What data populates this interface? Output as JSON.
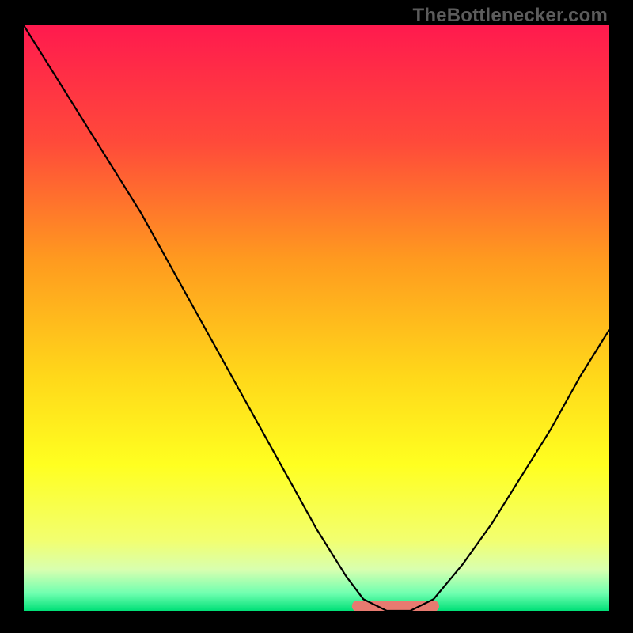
{
  "watermark": {
    "text": "TheBottlenecker.com"
  },
  "gradient": {
    "stops": [
      {
        "offset": 0.0,
        "color": "#ff1a4e"
      },
      {
        "offset": 0.2,
        "color": "#ff4a3a"
      },
      {
        "offset": 0.4,
        "color": "#ff9a1f"
      },
      {
        "offset": 0.6,
        "color": "#ffd81a"
      },
      {
        "offset": 0.75,
        "color": "#ffff20"
      },
      {
        "offset": 0.88,
        "color": "#f2ff70"
      },
      {
        "offset": 0.93,
        "color": "#d8ffb0"
      },
      {
        "offset": 0.97,
        "color": "#70ffb0"
      },
      {
        "offset": 1.0,
        "color": "#00e077"
      }
    ]
  },
  "chart_data": {
    "type": "line",
    "title": "",
    "xlabel": "",
    "ylabel": "",
    "xlim": [
      0,
      100
    ],
    "ylim": [
      0,
      100
    ],
    "series": [
      {
        "name": "curve",
        "x": [
          0,
          5,
          10,
          15,
          20,
          25,
          30,
          35,
          40,
          45,
          50,
          55,
          58,
          62,
          66,
          70,
          75,
          80,
          85,
          90,
          95,
          100
        ],
        "values": [
          100,
          92,
          84,
          76,
          68,
          59,
          50,
          41,
          32,
          23,
          14,
          6,
          2,
          0,
          0,
          2,
          8,
          15,
          23,
          31,
          40,
          48
        ]
      }
    ],
    "optimal_band": {
      "name": "optimal-range-marker",
      "x_start": 57,
      "x_end": 70,
      "color": "#e77a70"
    }
  }
}
